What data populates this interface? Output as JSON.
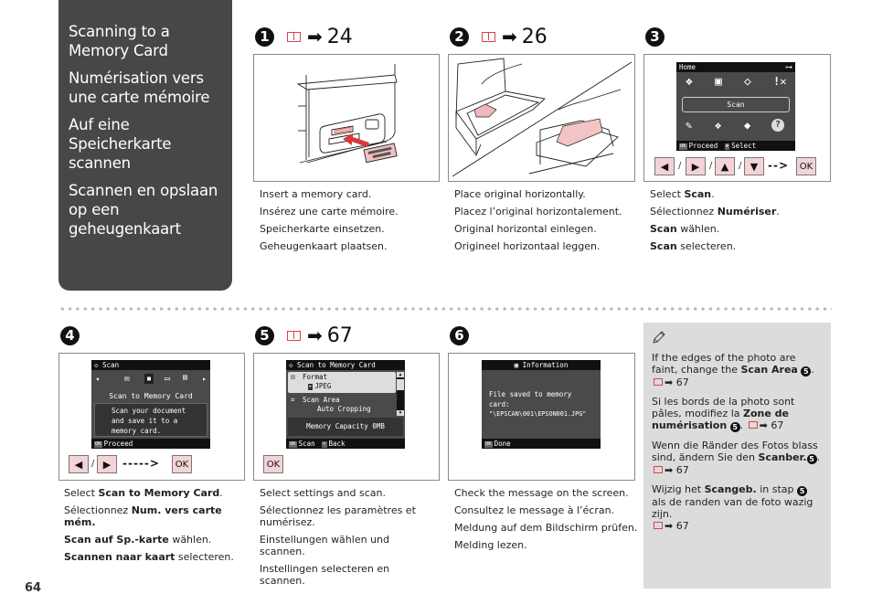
{
  "sidebar": {
    "titles": [
      "Scanning to a Memory Card",
      "Numérisation vers une carte mémoire",
      "Auf eine Speicherkarte scannen",
      "Scannen en opslaan op een geheugenkaart"
    ]
  },
  "steps": [
    {
      "number": "1",
      "ref_page": "24",
      "captions": [
        "Insert a memory card.",
        "Insérez une carte mémoire.",
        "Speicherkarte einsetzen.",
        "Geheugenkaart plaatsen."
      ]
    },
    {
      "number": "2",
      "ref_page": "26",
      "captions": [
        "Place original horizontally.",
        "Placez l’original horizontalement.",
        "Original horizontal einlegen.",
        "Origineel horizontaal leggen."
      ]
    },
    {
      "number": "3",
      "lcd": {
        "title": "Home",
        "selected": "Scan",
        "footer_ok": "OK",
        "footer_proceed": "Proceed",
        "footer_select": "Select"
      },
      "buttons": [
        "◀",
        "▶",
        "▲",
        "▼"
      ],
      "ok_label": "OK",
      "captions": [
        {
          "pre": "Select ",
          "bold": "Scan",
          "post": "."
        },
        {
          "pre": "Sélectionnez ",
          "bold": "Numériser",
          "post": "."
        },
        {
          "pre": "",
          "bold": "Scan",
          "post": " wählen."
        },
        {
          "pre": "",
          "bold": "Scan",
          "post": " selecteren."
        }
      ]
    },
    {
      "number": "4",
      "lcd": {
        "title": "Scan",
        "selected": "Scan to Memory Card",
        "description": "Scan your document and save it to a memory card.",
        "footer_ok": "OK",
        "footer_proceed": "Proceed"
      },
      "buttons": [
        "◀",
        "▶"
      ],
      "ok_label": "OK",
      "captions": [
        {
          "pre": "Select ",
          "bold": "Scan to Memory Card",
          "post": "."
        },
        {
          "pre": "Sélectionnez ",
          "bold": "Num. vers carte mém.",
          "post": ""
        },
        {
          "pre": "",
          "bold": "Scan auf Sp.-karte",
          "post": " wählen."
        },
        {
          "pre": "",
          "bold": "Scannen naar kaart",
          "post": " selecteren."
        }
      ]
    },
    {
      "number": "5",
      "ref_page": "67",
      "lcd": {
        "title": "Scan to Memory Card",
        "format_label": "Format",
        "format_value": "JPEG",
        "area_label": "Scan Area",
        "area_value": "Auto Cropping",
        "capacity": "Memory Capacity 0MB",
        "footer_ok": "OK",
        "footer_scan": "Scan",
        "footer_back": "Back"
      },
      "ok_label": "OK",
      "captions": [
        "Select settings and scan.",
        "Sélectionnez les paramètres et numérisez.",
        "Einstellungen wählen und scannen.",
        "Instellingen selecteren en scannen."
      ]
    },
    {
      "number": "6",
      "lcd": {
        "title": "Information",
        "message_1": "File saved to memory",
        "message_2": "card:",
        "message_3": "\"\\EPSCAN\\001\\EPSON001.JPG\"",
        "footer_ok": "OK",
        "footer_done": "Done"
      },
      "captions": [
        "Check the message on the screen.",
        "Consultez le message à l’écran.",
        "Meldung auf dem Bildschirm prüfen.",
        "Melding lezen."
      ]
    }
  ],
  "note": {
    "icon": "pencil-icon",
    "ref_page": "67",
    "step_ref": "5",
    "en": {
      "pre": "If the edges of the photo are faint, change the ",
      "bold": "Scan Area"
    },
    "fr": {
      "pre": "Si les bords de la photo sont pâles, modifiez la ",
      "bold": "Zone de numérisation"
    },
    "de": {
      "pre": "Wenn die Ränder des Fotos blass sind, ändern Sie den ",
      "bold": "Scanber."
    },
    "nl": {
      "pre": "Wijzig het ",
      "bold": "Scangeb.",
      "mid": " in stap ",
      "post": " als de randen van de foto wazig zijn."
    }
  },
  "page_number": "64",
  "colors": {
    "sidebar_bg": "#474747",
    "accent_red": "#d9434a",
    "button_pink": "#f3d3d6",
    "note_bg": "#dcdcdc"
  }
}
